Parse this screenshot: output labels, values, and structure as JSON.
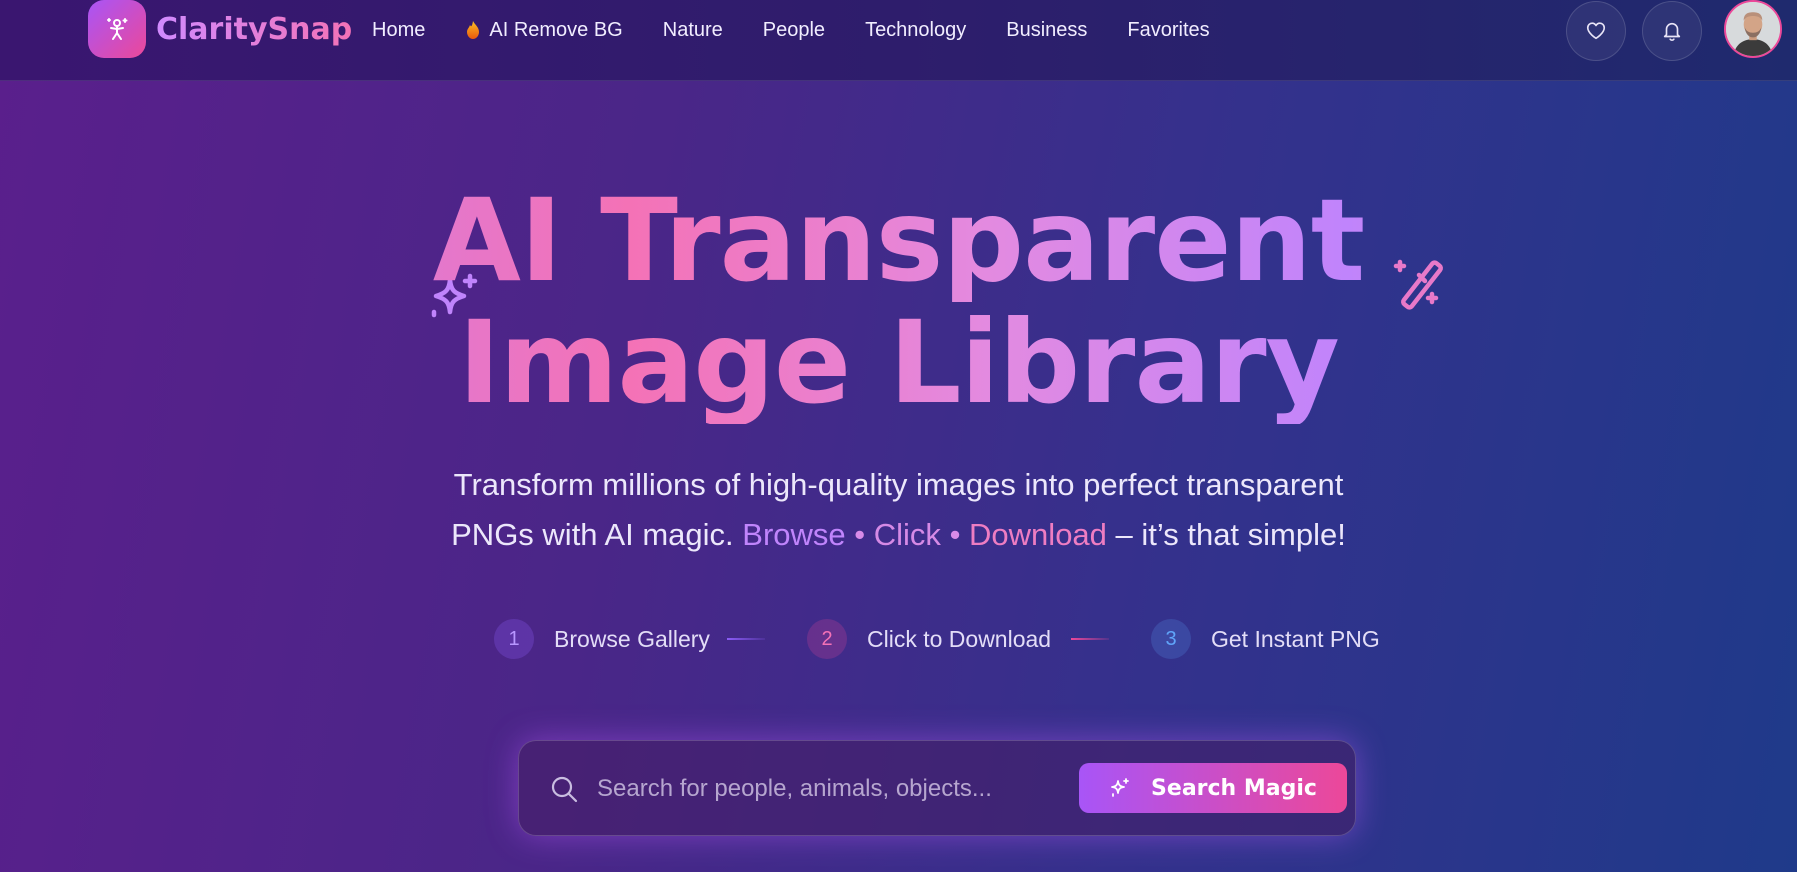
{
  "brand": {
    "name": "ClaritySnap"
  },
  "nav": {
    "items": [
      {
        "label": "Home"
      },
      {
        "label": "AI Remove BG"
      },
      {
        "label": "Nature"
      },
      {
        "label": "People"
      },
      {
        "label": "Technology"
      },
      {
        "label": "Business"
      },
      {
        "label": "Favorites"
      }
    ]
  },
  "hero": {
    "title_line1": "AI Transparent",
    "title_line2": "Image Library",
    "subtitle_line1": "Transform millions of high-quality images into perfect transparent",
    "subtitle_line2_prefix": "PNGs with AI magic.",
    "subtitle_browse": "Browse",
    "subtitle_dot": "•",
    "subtitle_click": "Click",
    "subtitle_download": "Download",
    "subtitle_suffix": "– it’s that simple!"
  },
  "steps": [
    {
      "number": "1",
      "label": "Browse Gallery"
    },
    {
      "number": "2",
      "label": "Click to Download"
    },
    {
      "number": "3",
      "label": "Get Instant PNG"
    }
  ],
  "search": {
    "placeholder": "Search for people, animals, objects...",
    "value": "",
    "button_label": "Search Magic"
  },
  "icons": {
    "logo": "person-sparkle-icon",
    "trending": "flame-icon",
    "favorites": "heart-icon",
    "notifications": "bell-icon",
    "hero_left": "sparkles-icon",
    "hero_right": "magic-wand-icon",
    "search": "search-icon",
    "search_button": "sparkles-icon"
  },
  "colors": {
    "accent_purple": "#a855f7",
    "accent_pink": "#ec4899",
    "text_highlight_purple": "#c084fc",
    "text_highlight_pink": "#f472b6",
    "step1": "#8b5cf6",
    "step2": "#ec4899",
    "step3": "#60a5fa"
  }
}
